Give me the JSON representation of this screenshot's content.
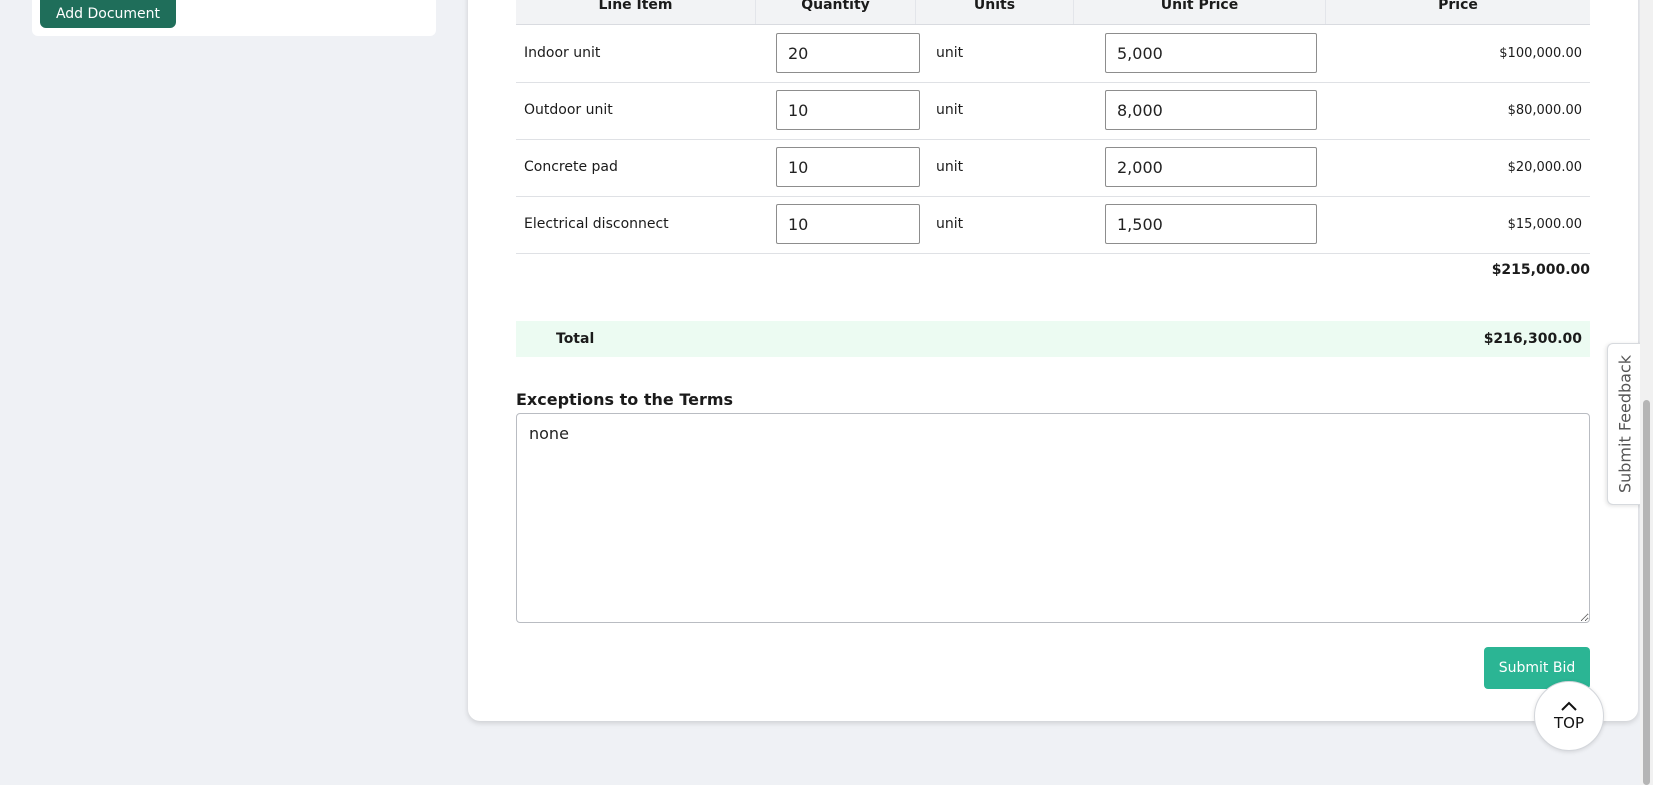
{
  "left_panel": {
    "add_document_label": "Add Document"
  },
  "table": {
    "headers": [
      "Line Item",
      "Quantity",
      "Units",
      "Unit Price",
      "Price"
    ],
    "rows": [
      {
        "item": "Indoor unit",
        "quantity": "20",
        "units": "unit",
        "unit_price": "5,000",
        "price": "$100,000.00"
      },
      {
        "item": "Outdoor unit",
        "quantity": "10",
        "units": "unit",
        "unit_price": "8,000",
        "price": "$80,000.00"
      },
      {
        "item": "Concrete pad",
        "quantity": "10",
        "units": "unit",
        "unit_price": "2,000",
        "price": "$20,000.00"
      },
      {
        "item": "Electrical disconnect",
        "quantity": "10",
        "units": "unit",
        "unit_price": "1,500",
        "price": "$15,000.00"
      }
    ],
    "subtotal": "$215,000.00"
  },
  "total": {
    "label": "Total",
    "value": "$216,300.00"
  },
  "exceptions": {
    "label": "Exceptions to the Terms",
    "value": "none"
  },
  "actions": {
    "submit_label": "Submit Bid",
    "top_label": "TOP"
  },
  "feedback": {
    "label": "Submit Feedback"
  },
  "colors": {
    "primary_dark": "#1f6e5a",
    "accent_green": "#2bb594",
    "total_bg": "#ecfbf2",
    "page_bg": "#eff1f5"
  },
  "icons": {
    "top": "chevron-up-icon"
  }
}
